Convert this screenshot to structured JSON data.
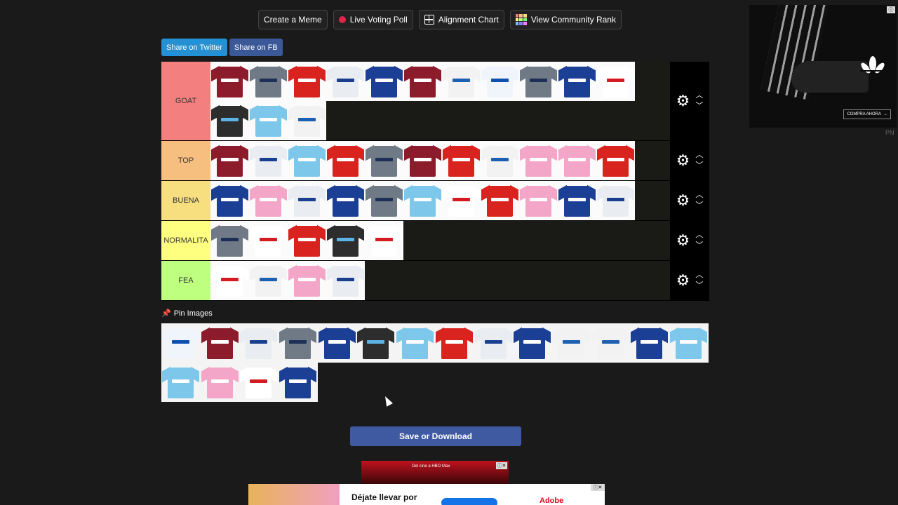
{
  "toolbar": {
    "create_meme": "Create a Meme",
    "live_poll": "Live Voting Poll",
    "alignment_chart": "Alignment Chart",
    "community_rank": "View Community Rank"
  },
  "share": {
    "twitter": "Share on Twitter",
    "facebook": "Share on FB"
  },
  "tiers": [
    {
      "label": "GOAT",
      "color": "#f47f7f",
      "item_count": 14
    },
    {
      "label": "TOP",
      "color": "#f7bf7f",
      "item_count": 11
    },
    {
      "label": "BUENA",
      "color": "#f7df7f",
      "item_count": 11
    },
    {
      "label": "NORMALITA",
      "color": "#ffff7f",
      "item_count": 5
    },
    {
      "label": "FEA",
      "color": "#bfff7f",
      "item_count": 4
    }
  ],
  "pin_images": {
    "label": "Pin Images",
    "item_count": 18
  },
  "save_button": "Save or Download",
  "ads": {
    "top_cta": "COMPRA AHORA",
    "pn": "PN",
    "mid_text": "Del cine a HBO Max",
    "bottom_text": "Déjate llevar por",
    "bottom_brand": "Adobe"
  },
  "colors": {
    "background": "#1a1a1b",
    "twitter": "#2591d4",
    "facebook": "#3b5998",
    "save": "#3f5aa0",
    "live_dot": "#e0254a"
  }
}
